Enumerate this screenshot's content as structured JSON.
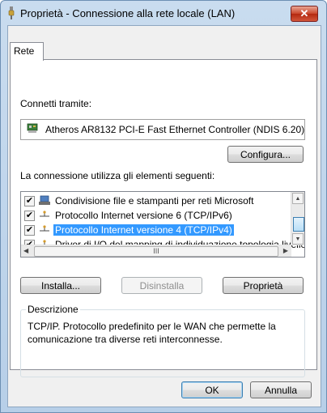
{
  "window": {
    "title": "Proprietà - Connessione alla rete locale (LAN)",
    "close_label": "✕"
  },
  "tabs": [
    {
      "label": "Rete"
    }
  ],
  "connect_using": {
    "label": "Connetti tramite:",
    "adapter": "Atheros AR8132 PCI-E Fast Ethernet Controller (NDIS 6.20)"
  },
  "buttons": {
    "configure": "Configura...",
    "install": "Installa...",
    "uninstall": "Disinstalla",
    "properties": "Proprietà",
    "ok": "OK",
    "cancel": "Annulla"
  },
  "items_label": "La connessione utilizza gli elementi seguenti:",
  "items": [
    {
      "label": "Condivisione file e stampanti per reti Microsoft",
      "checked": true,
      "icon": "network-service-icon"
    },
    {
      "label": "Protocollo Internet versione 6 (TCP/IPv6)",
      "checked": true,
      "icon": "protocol-icon"
    },
    {
      "label": "Protocollo Internet versione 4 (TCP/IPv4)",
      "checked": true,
      "icon": "protocol-icon",
      "selected": true
    },
    {
      "label": "Driver di I/O del mapping di individuazione topologia livello collegamento",
      "checked": true,
      "icon": "protocol-icon"
    }
  ],
  "hscroll_grip": "III",
  "description": {
    "legend": "Descrizione",
    "text": "TCP/IP. Protocollo predefinito per le WAN che permette la comunicazione tra diverse reti interconnesse."
  },
  "colors": {
    "selection": "#3399ff",
    "close_button": "#c9452a"
  }
}
